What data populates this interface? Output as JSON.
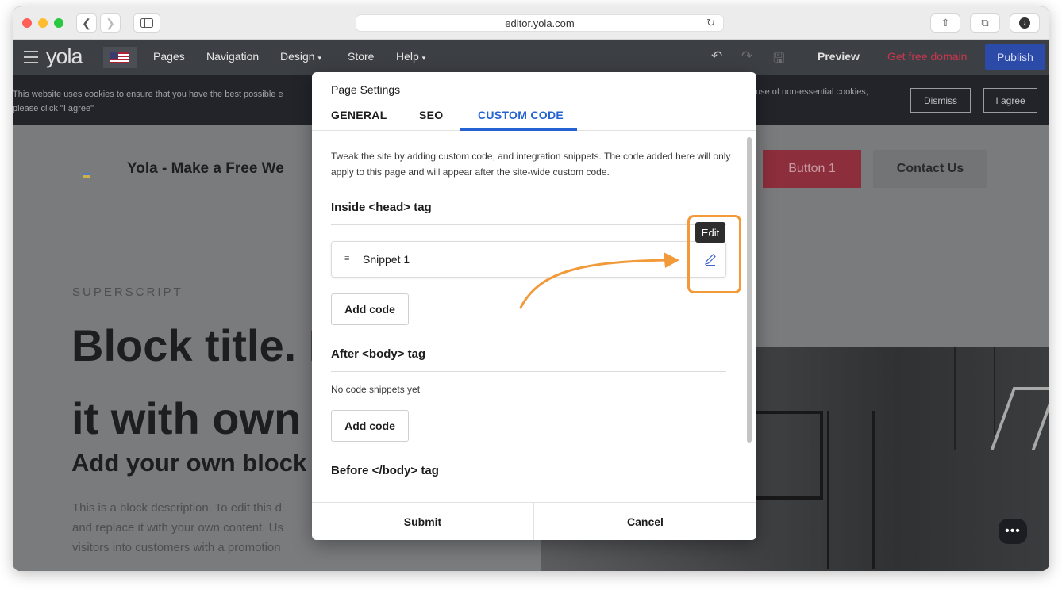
{
  "browser": {
    "url": "editor.yola.com"
  },
  "editor": {
    "logo": "yola",
    "menu": [
      "Pages",
      "Navigation",
      "Design",
      "Store",
      "Help"
    ],
    "preview_label": "Preview",
    "free_domain_label": "Get free domain",
    "publish_label": "Publish"
  },
  "cookie": {
    "text": "This website uses cookies to ensure that you have the best possible e",
    "text2": "please click \"I agree\"",
    "text3": "use of non-essential cookies,",
    "dismiss": "Dismiss",
    "agree": "I agree"
  },
  "site": {
    "title": "Yola - Make a Free We",
    "button1": "Button 1",
    "contact": "Contact Us",
    "superscript": "SUPERSCRIPT",
    "block_title_line1": "Block title. R",
    "block_title_line2": "it with own c",
    "block_subtitle": "Add your own block s",
    "desc_line1": "This is a block description. To edit this d",
    "desc_line2": "and replace it with your own content. Us",
    "desc_line3": "visitors into customers with a promotion"
  },
  "modal": {
    "title": "Page Settings",
    "tabs": [
      "GENERAL",
      "SEO",
      "CUSTOM CODE"
    ],
    "active_tab": "CUSTOM CODE",
    "description": "Tweak the site by adding custom code, and integration snippets. The code added here will only apply to this page and will appear after the site-wide custom code.",
    "sections": [
      {
        "heading": "Inside <head> tag",
        "snippet": "Snippet 1",
        "add_label": "Add code"
      },
      {
        "heading": "After <body> tag",
        "empty": "No code snippets yet",
        "add_label": "Add code"
      },
      {
        "heading": "Before </body> tag"
      }
    ],
    "submit": "Submit",
    "cancel": "Cancel"
  },
  "annotation": {
    "tooltip": "Edit",
    "accent_color": "#f29a3a"
  }
}
